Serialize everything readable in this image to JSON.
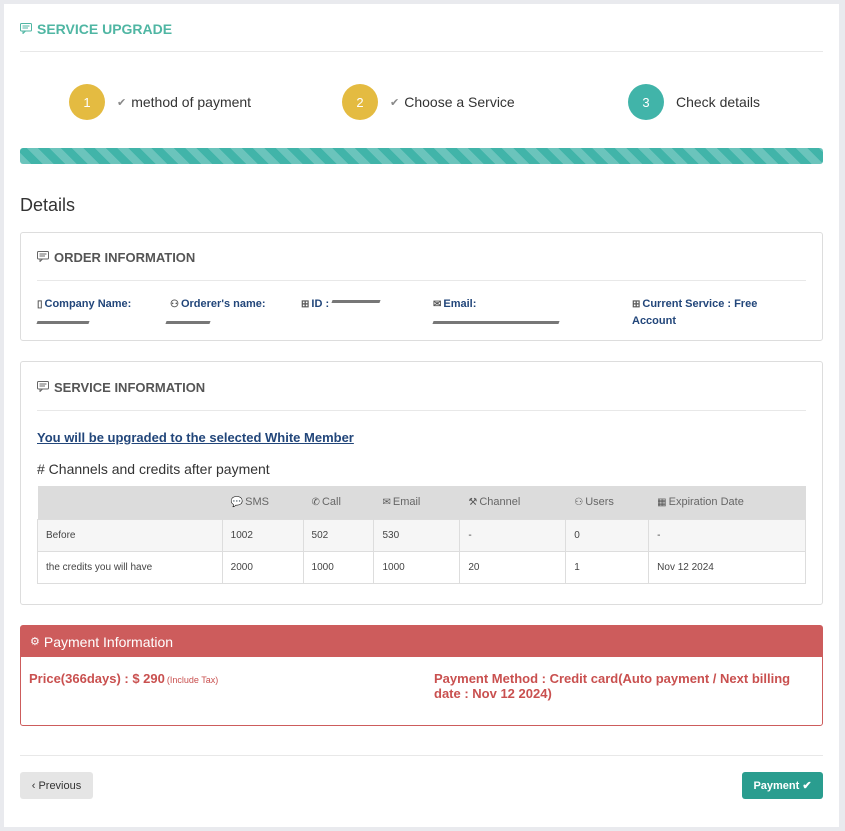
{
  "header": {
    "title": "SERVICE UPGRADE"
  },
  "steps": [
    {
      "number": "1",
      "label": "method of payment",
      "checked": true,
      "color": "#e4bb41"
    },
    {
      "number": "2",
      "label": "Choose a Service",
      "checked": true,
      "color": "#e4bb41"
    },
    {
      "number": "3",
      "label": "Check details",
      "checked": false,
      "color": "#41b4a9"
    }
  ],
  "progress": {
    "percent": 100,
    "color": "#41b4a9"
  },
  "details_title": "Details",
  "order_info": {
    "title": "ORDER INFORMATION",
    "company_label": "Company Name:",
    "orderer_label": "Orderer's name:",
    "id_label": "ID :",
    "email_label": "Email:",
    "service_label": "Current Service : Free Account"
  },
  "service_info": {
    "title": "SERVICE INFORMATION",
    "upgrade_text": "You will be upgraded to the selected White Member",
    "channels_title": "# Channels and credits after payment",
    "columns": [
      "",
      "SMS",
      "Call",
      "Email",
      "Channel",
      "Users",
      "Expiration Date"
    ],
    "rows": [
      [
        "Before",
        "1002",
        "502",
        "530",
        "-",
        "0",
        "-"
      ],
      [
        "the credits you will have",
        "2000",
        "1000",
        "1000",
        "20",
        "1",
        "Nov 12 2024"
      ]
    ]
  },
  "payment": {
    "title": "Payment Information",
    "price": "Price(366days) : $ 290",
    "tax_note": "(Include Tax)",
    "method": "Payment Method : Credit card(Auto payment / Next billing date : Nov 12 2024)",
    "accent_color": "#cd5c5c"
  },
  "buttons": {
    "previous": "Previous",
    "payment": "Payment"
  }
}
